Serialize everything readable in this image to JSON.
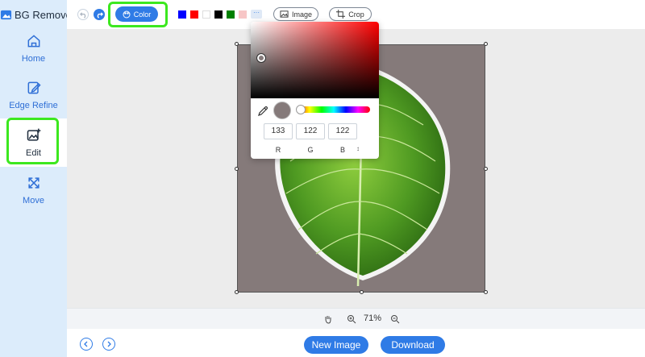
{
  "app": {
    "name": "BG Remover"
  },
  "sidebar": {
    "items": [
      {
        "label": "Home",
        "icon": "home-icon"
      },
      {
        "label": "Edge Refine",
        "icon": "edit-pen-icon"
      },
      {
        "label": "Edit",
        "icon": "image-edit-icon",
        "active": true
      },
      {
        "label": "Move",
        "icon": "move-arrows-icon"
      }
    ]
  },
  "toolbar": {
    "color_label": "Color",
    "image_label": "Image",
    "crop_label": "Crop",
    "more_label": "···",
    "swatches": [
      "#0000ff",
      "#ff0000",
      "#ffffff",
      "#000000",
      "#008000",
      "#f7c6c6"
    ]
  },
  "color_picker": {
    "r": "133",
    "g": "122",
    "b": "122",
    "r_label": "R",
    "g_label": "G",
    "b_label": "B",
    "mode_toggle": "↕"
  },
  "canvas": {
    "background_color": "#857a7a"
  },
  "zoom": {
    "level": "71%"
  },
  "footer": {
    "new_image_label": "New Image",
    "download_label": "Download"
  },
  "colors": {
    "accent": "#2f7be6",
    "highlight": "#3ce81f",
    "sidebar": "#dcecfb"
  }
}
